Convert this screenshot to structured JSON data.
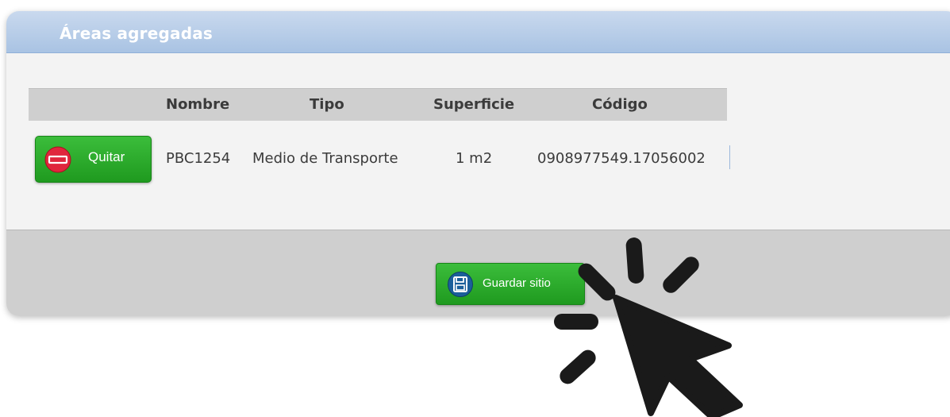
{
  "panel": {
    "title": "Áreas agregadas"
  },
  "table": {
    "columns": [
      "",
      "Nombre",
      "Tipo",
      "Superficie",
      "Código"
    ],
    "rows": [
      {
        "remove_label": "Quitar",
        "nombre": "PBC1254",
        "tipo": "Medio de Transporte",
        "superficie": "1 m2",
        "codigo": "0908977549.17056002"
      }
    ]
  },
  "footer": {
    "save_label": "Guardar sitio"
  },
  "icons": {
    "remove": "minus-circle-icon",
    "save": "floppy-disk-icon",
    "cursor": "mouse-pointer-click-icon"
  },
  "colors": {
    "header_blue": "#a9c3e3",
    "button_green": "#2bab2b",
    "remove_red": "#e0263d",
    "save_icon_blue": "#1b5f9a"
  }
}
